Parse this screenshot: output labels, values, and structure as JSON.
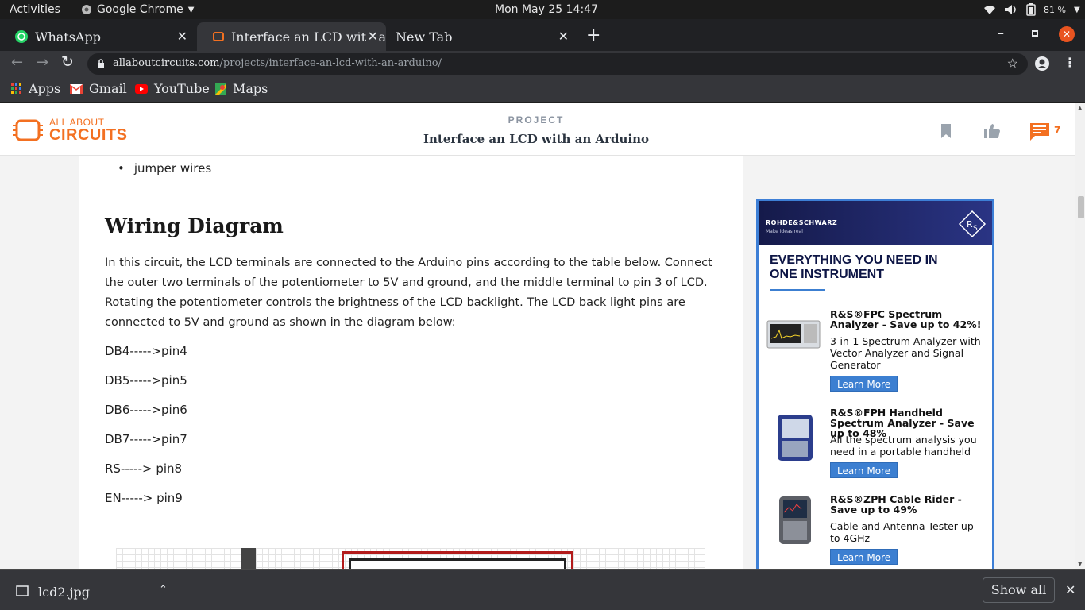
{
  "os": {
    "activities": "Activities",
    "app_name": "Google Chrome",
    "datetime": "Mon May 25  14:47",
    "battery": "81 %"
  },
  "tabs": [
    {
      "title": "WhatsApp"
    },
    {
      "title": "Interface  an  LCD  with  a"
    },
    {
      "title": "New  Tab"
    }
  ],
  "toolbar": {
    "url_domain": "allaboutcircuits.com",
    "url_path": "/projects/interface-an-lcd-with-an-arduino/"
  },
  "bookmarks": [
    {
      "label": "Apps",
      "icon": "apps-grid-icon"
    },
    {
      "label": "Gmail",
      "icon": "gmail-icon"
    },
    {
      "label": "YouTube",
      "icon": "youtube-icon"
    },
    {
      "label": "Maps",
      "icon": "maps-icon"
    }
  ],
  "site": {
    "logo_top": "ALL ABOUT",
    "logo_bottom": "CIRCUITS",
    "section": "PROJECT",
    "title": "Interface an LCD with an Arduino",
    "comment_count": "7",
    "brand_color": "#f37021"
  },
  "article": {
    "bullet": "jumper wires",
    "heading": "Wiring Diagram",
    "paragraph": "In this circuit, the LCD terminals are connected to the Arduino pins according to the table below. Connect the outer two terminals of the potentiometer to 5V and ground, and the middle terminal to pin 3 of LCD. Rotating the potentiometer controls the brightness of the LCD backlight. The LCD back light pins are connected to 5V and ground as shown in the diagram below:",
    "pins": [
      "DB4----->pin4",
      "DB5----->pin5",
      "DB6----->pin6",
      "DB7----->pin7",
      "RS-----> pin8",
      "EN-----> pin9"
    ]
  },
  "ad": {
    "brand": "ROHDE&SCHWARZ",
    "tagline": "Make ideas real",
    "headline_1": "EVERYTHING YOU NEED IN",
    "headline_2": "ONE INSTRUMENT",
    "products": [
      {
        "name": "R&S®FPC Spectrum Analyzer - Save up to 42%!",
        "desc": "3-in-1 Spectrum Analyzer with Vector Analyzer and Signal Generator",
        "cta": "Learn More"
      },
      {
        "name": "R&S®FPH Handheld Spectrum Analyzer - Save up to 48%",
        "desc": "All the spectrum analysis you need in a portable handheld",
        "cta": "Learn More"
      },
      {
        "name": "R&S®ZPH Cable Rider - Save up to 49%",
        "desc": "Cable and Antenna Tester up to 4GHz",
        "cta": "Learn More"
      }
    ]
  },
  "downloads": {
    "file": "lcd2.jpg",
    "show_all": "Show  all"
  }
}
